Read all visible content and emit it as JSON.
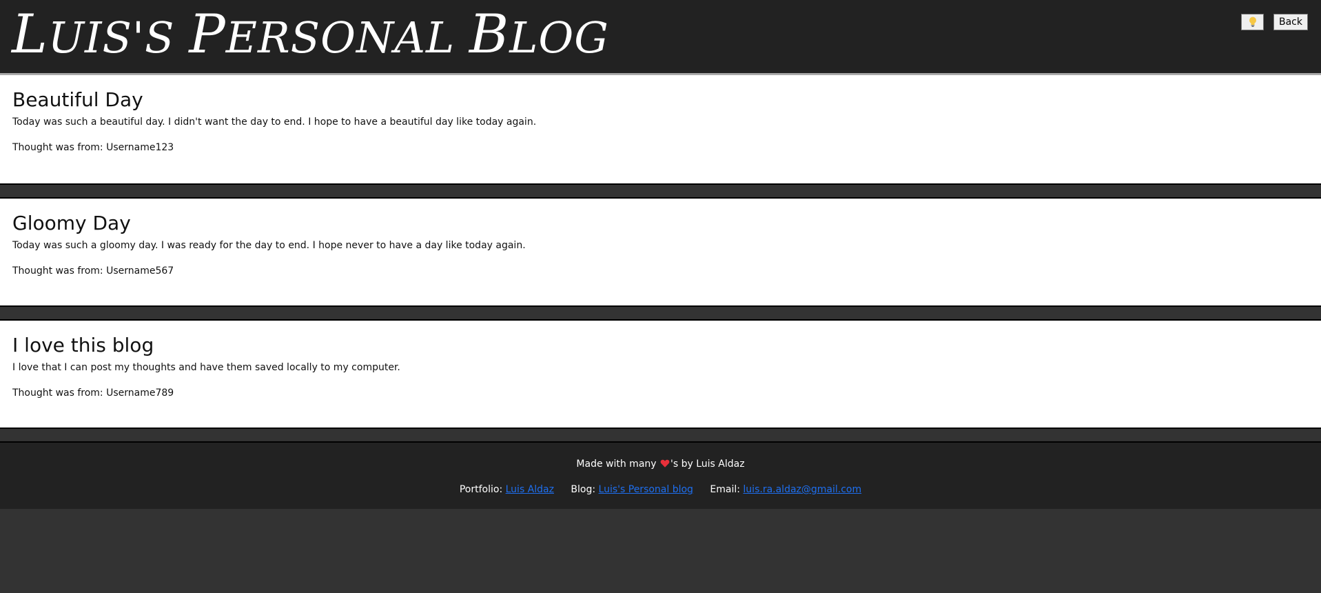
{
  "header": {
    "title_first": "L",
    "title_rest_1": "UIS'S ",
    "title_p": "P",
    "title_rest_2": "ERSONAL ",
    "title_b": "B",
    "title_rest_3": "LOG",
    "theme_icon": "lightbulb-icon",
    "back_label": "Back"
  },
  "posts": [
    {
      "title": "Beautiful Day",
      "body": "Today was such a beautiful day. I didn't want the day to end. I hope to have a beautiful day like today again.",
      "author": "Thought was from: Username123"
    },
    {
      "title": "Gloomy Day",
      "body": "Today was such a gloomy day. I was ready for the day to end. I hope never to have a day like today again.",
      "author": "Thought was from: Username567"
    },
    {
      "title": "I love this blog",
      "body": "I love that I can post my thoughts and have them saved locally to my computer.",
      "author": "Thought was from: Username789"
    }
  ],
  "footer": {
    "made_prefix": "Made with many",
    "made_suffix": "'s by Luis Aldaz",
    "heart_icon": "heart-icon",
    "portfolio_label": "Portfolio:",
    "portfolio_link": "Luis Aldaz",
    "blog_label": "Blog:",
    "blog_link": "Luis's Personal blog",
    "email_label": "Email:",
    "email_link": "luis.ra.aldaz@gmail.com"
  },
  "colors": {
    "header_bg": "#222222",
    "page_bg": "#333333",
    "card_bg": "#ffffff",
    "link": "#1e6ff0"
  }
}
